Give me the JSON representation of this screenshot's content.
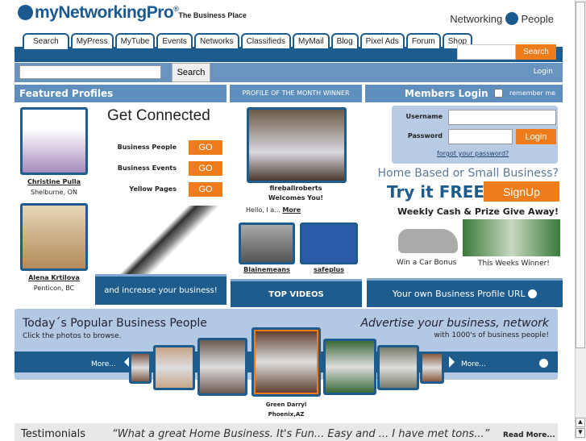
{
  "header": {
    "logo": "myNetworkingPro",
    "registered": "®",
    "tagline": "The Business Place",
    "partner_left": "Networking",
    "partner_right": "People"
  },
  "tabs": [
    "Search",
    "MyPress",
    "MyTube",
    "Events",
    "Networks",
    "Classifieds",
    "MyMail",
    "Blog",
    "Pixel Ads",
    "Forum",
    "Shop"
  ],
  "top_search": {
    "button": "Search"
  },
  "search_bar": {
    "button": "Search",
    "login": "Login"
  },
  "featured": {
    "title": "Featured Profiles",
    "profiles": [
      {
        "name": "Christine Pulla",
        "location": "Shelburne, ON"
      },
      {
        "name": "Alena Krtilova",
        "location": "Penticon, BC"
      }
    ]
  },
  "connect": {
    "title": "Get Connected",
    "rows": [
      {
        "label": "Business People",
        "button": "GO"
      },
      {
        "label": "Business Events",
        "button": "GO"
      },
      {
        "label": "Yellow Pages",
        "button": "GO"
      }
    ],
    "banner": "and increase your business!"
  },
  "potm": {
    "title": "PROFILE OF THE MONTH WINNER",
    "name": "fireballroberts",
    "welcome": "Welcomes You!",
    "intro": "Hello, I a...",
    "more": "More",
    "videos": [
      {
        "name": "Blainemeans"
      },
      {
        "name": "safeplus"
      }
    ],
    "top_videos": "TOP VIDEOS"
  },
  "login": {
    "title": "Members Login",
    "remember": "remember me",
    "username_label": "Username",
    "password_label": "Password",
    "button": "Login",
    "forgot": "forgot your password?"
  },
  "promo": {
    "question": "Home Based or Small Business?",
    "try": "Try it FREE!",
    "signup": "SignUp",
    "giveaway": "Weekly Cash & Prize Give Away!",
    "car": "Win a Car Bonus",
    "winner": "This Weeks Winner!",
    "profile_url": "Your own Business Profile URL"
  },
  "popular": {
    "title": "Today´s Popular Business People",
    "subtitle": "Click the photos to browse.",
    "advert": "Advertise your business, network",
    "advert_sub": "with 1000's of business people!",
    "more_left": "More...",
    "more_right": "More...",
    "featured_name": "Green Darryl",
    "featured_location": "Phoenix,AZ"
  },
  "testimonials": {
    "title": "Testimonials",
    "quote": "“What a great Home Business. It's Fun... Easy and ... I have met tons...”",
    "read_more": "Read More..."
  },
  "colors": {
    "brand": "#1d5c8c",
    "accent": "#ef7c1b",
    "light": "#6a94c0"
  }
}
